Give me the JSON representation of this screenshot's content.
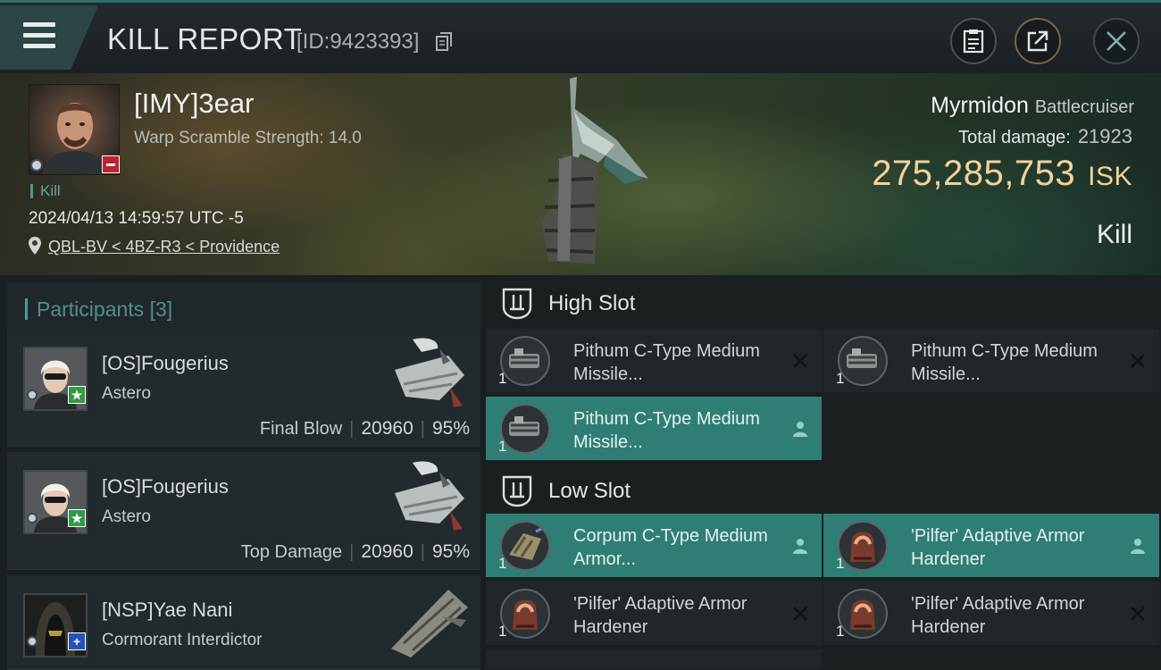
{
  "header": {
    "title": "KILL REPORT",
    "kill_id": "[ID:9423393]"
  },
  "victim": {
    "name": "[IMY]3ear",
    "warp_scramble": "Warp Scramble Strength: 14.0",
    "tag": "Kill",
    "timestamp": "2024/04/13 14:59:57 UTC -5",
    "location": "QBL-BV < 4BZ-R3 < Providence",
    "ship": "Myrmidon",
    "ship_class": "Battlecruiser",
    "total_damage_label": "Total damage:",
    "total_damage": "21923",
    "isk_value": "275,285,753",
    "isk_unit": "ISK",
    "result": "Kill"
  },
  "participants": {
    "title": "Participants",
    "count": "[3]",
    "rows": [
      {
        "name": "[OS]Fougerius",
        "ship": "Astero",
        "role": "Final Blow",
        "damage": "20960",
        "percent": "95%",
        "badge": "★"
      },
      {
        "name": "[OS]Fougerius",
        "ship": "Astero",
        "role": "Top Damage",
        "damage": "20960",
        "percent": "95%",
        "badge": "★"
      },
      {
        "name": "[NSP]Yae Nani",
        "ship": "Cormorant Interdictor",
        "badge": "+"
      }
    ]
  },
  "fitting": {
    "high_slot_title": "High Slot",
    "low_slot_title": "Low Slot",
    "high_slot": [
      {
        "name": "Pithum C-Type Medium Missile...",
        "qty": "1",
        "status": "destroyed"
      },
      {
        "name": "Pithum C-Type Medium Missile...",
        "qty": "1",
        "status": "destroyed"
      },
      {
        "name": "Pithum C-Type Medium Missile...",
        "qty": "1",
        "status": "dropped"
      }
    ],
    "low_slot": [
      {
        "name": "Corpum C-Type Medium Armor...",
        "qty": "1",
        "status": "dropped"
      },
      {
        "name": "'Pilfer' Adaptive Armor Hardener",
        "qty": "1",
        "status": "dropped"
      },
      {
        "name": "'Pilfer' Adaptive Armor Hardener",
        "qty": "1",
        "status": "destroyed"
      },
      {
        "name": "'Pilfer' Adaptive Armor Hardener",
        "qty": "1",
        "status": "destroyed"
      }
    ]
  },
  "colors": {
    "accent_teal": "#2f7e76",
    "isk_gold": "#f3d199",
    "standing_negative": "#c0232a",
    "standing_positive": "#2f9b44",
    "standing_fleet": "#2453b8"
  }
}
